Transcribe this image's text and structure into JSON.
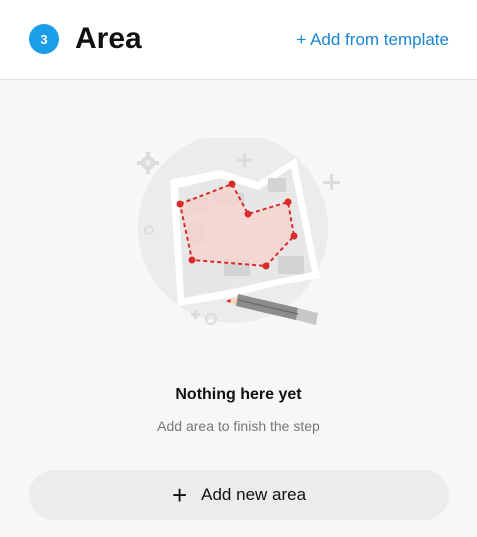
{
  "header": {
    "step_number": "3",
    "title": "Area",
    "template_link": "+ Add from template"
  },
  "empty_state": {
    "title": "Nothing here yet",
    "subtitle": "Add area to finish the step",
    "illustration_icon": "map-area-illustration"
  },
  "actions": {
    "add_icon": "+",
    "add_label": "Add new area"
  },
  "colors": {
    "accent": "#1a9ee8",
    "link": "#1a86d0",
    "area_outline": "#d92b2b"
  }
}
